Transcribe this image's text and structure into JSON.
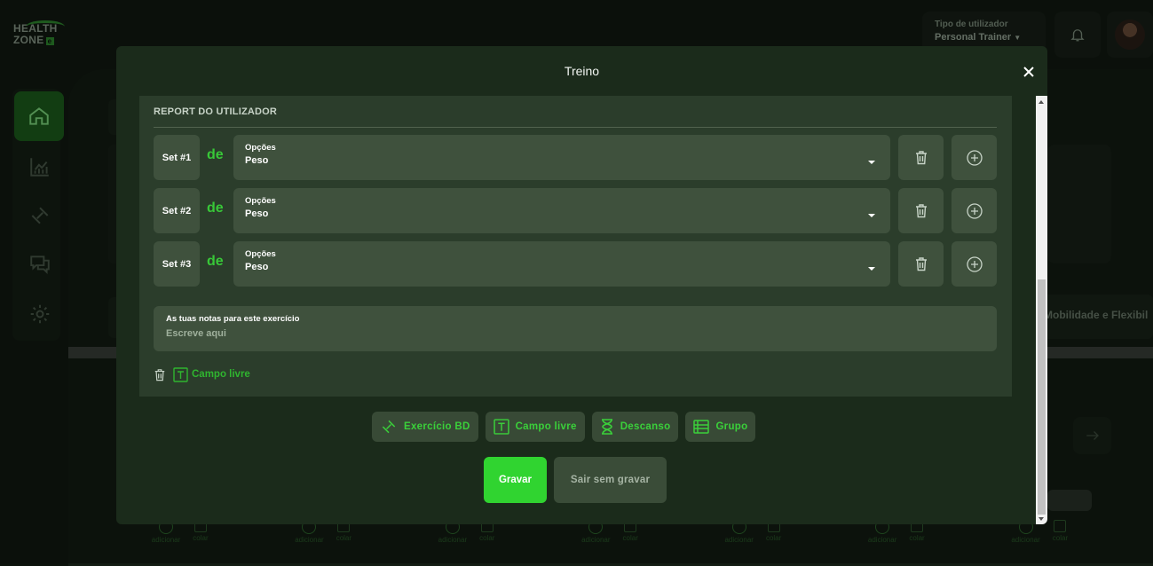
{
  "app": {
    "logo_line1": "HEALTH",
    "logo_line2": "ZONE",
    "logo_badge": "e",
    "accent_color": "#30d430"
  },
  "header": {
    "user_type_label": "Tipo de utilizador",
    "user_type_value": "Personal Trainer",
    "icons": [
      "bell-icon",
      "avatar"
    ]
  },
  "sidebar": {
    "items": [
      {
        "icon": "home-icon",
        "active": true
      },
      {
        "icon": "chart-icon",
        "active": false
      },
      {
        "icon": "dumbbell-icon",
        "active": false
      },
      {
        "icon": "chat-icon",
        "active": false
      },
      {
        "icon": "gear-icon",
        "active": false
      }
    ]
  },
  "background": {
    "tab_text": "Mobilidade e Flexibil",
    "slot_add_label": "adicionar",
    "slot_paste_label": "colar",
    "slot_count": 7
  },
  "modal": {
    "title": "Treino",
    "section_heading": "REPORT DO UTILIZADOR",
    "de_label": "de",
    "sets": [
      {
        "label": "Set #1",
        "options_label": "Opções",
        "options_value": "Peso"
      },
      {
        "label": "Set #2",
        "options_label": "Opções",
        "options_value": "Peso"
      },
      {
        "label": "Set #3",
        "options_label": "Opções",
        "options_value": "Peso"
      }
    ],
    "notes": {
      "label": "As tuas notas para este exercício",
      "placeholder": "Escreve aqui",
      "value": ""
    },
    "free_field_label": "Campo livre",
    "add_buttons": [
      {
        "icon": "dumbbell-icon",
        "label": "Exercício BD"
      },
      {
        "icon": "text-field-icon",
        "label": "Campo livre"
      },
      {
        "icon": "hourglass-icon",
        "label": "Descanso"
      },
      {
        "icon": "group-list-icon",
        "label": "Grupo"
      }
    ],
    "save_label": "Gravar",
    "exit_label": "Sair sem gravar"
  }
}
